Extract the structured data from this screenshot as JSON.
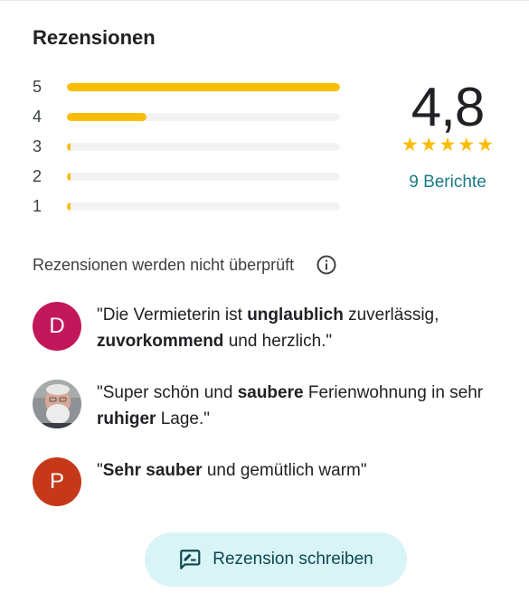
{
  "panel": {
    "title": "Rezensionen"
  },
  "rating_histogram": [
    {
      "stars": "5",
      "share": 1.0
    },
    {
      "stars": "4",
      "share": 0.29
    },
    {
      "stars": "3",
      "share": 0.01
    },
    {
      "stars": "2",
      "share": 0.01
    },
    {
      "stars": "1",
      "share": 0.01
    }
  ],
  "summary": {
    "score": "4,8",
    "star_rating": 5,
    "reviews_link": "9 Berichte"
  },
  "disclaimer": {
    "text": "Rezensionen werden nicht überprüft",
    "icon": "info-icon"
  },
  "reviews": [
    {
      "avatar_letter": "D",
      "avatar_color": "#c2185b",
      "segments": [
        {
          "t": "\"Die Vermieterin ist ",
          "b": false
        },
        {
          "t": "unglaublich",
          "b": true
        },
        {
          "t": " zuverlässig, ",
          "b": false
        },
        {
          "t": "zuvorkommend",
          "b": true
        },
        {
          "t": " und herzlich.\"",
          "b": false
        }
      ]
    },
    {
      "avatar_letter": "",
      "avatar_color": "#8a8f94",
      "avatar_photo": true,
      "segments": [
        {
          "t": "\"Super schön und ",
          "b": false
        },
        {
          "t": "saubere",
          "b": true
        },
        {
          "t": " Ferienwohnung in sehr ",
          "b": false
        },
        {
          "t": "ruhiger",
          "b": true
        },
        {
          "t": " Lage.\"",
          "b": false
        }
      ]
    },
    {
      "avatar_letter": "P",
      "avatar_color": "#c5391a",
      "segments": [
        {
          "t": "\"",
          "b": false
        },
        {
          "t": "Sehr sauber",
          "b": true
        },
        {
          "t": " und gemütlich warm\"",
          "b": false
        }
      ]
    }
  ],
  "write_button": {
    "label": "Rezension schreiben",
    "icon": "rate-review-icon"
  },
  "colors": {
    "star": "#fbbc04",
    "link": "#1a7c86",
    "button_bg": "#d9f4f7"
  }
}
